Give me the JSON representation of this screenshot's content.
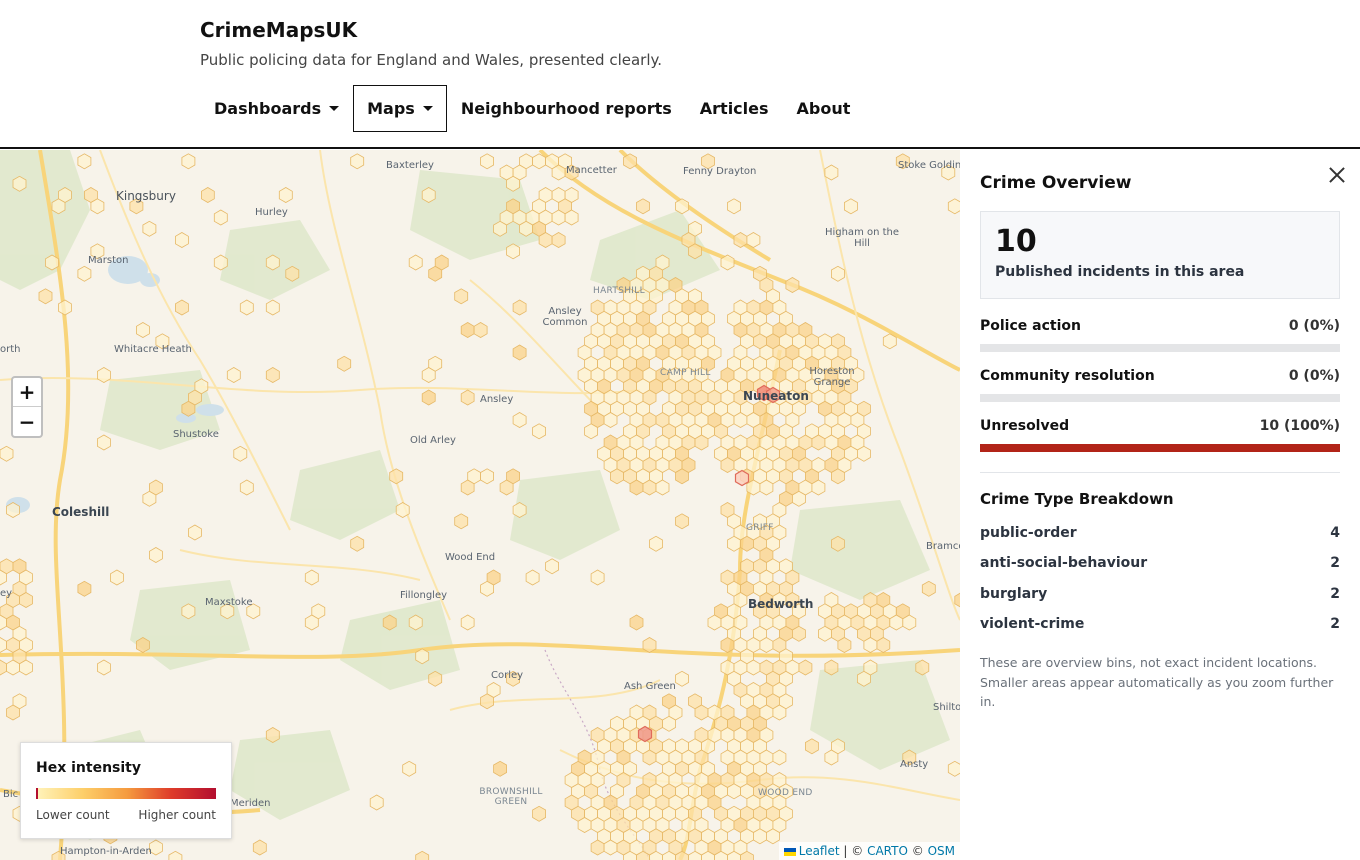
{
  "header": {
    "brand": "CrimeMapsUK",
    "tagline": "Public policing data for England and Wales, presented clearly.",
    "nav": [
      {
        "label": "Dashboards",
        "dropdown": true
      },
      {
        "label": "Maps",
        "dropdown": true,
        "active": true
      },
      {
        "label": "Neighbourhood reports"
      },
      {
        "label": "Articles"
      },
      {
        "label": "About"
      }
    ]
  },
  "map": {
    "places": {
      "kingsbury": "Kingsbury",
      "baxterley": "Baxterley",
      "mancetter": "Mancetter",
      "fenny_drayton": "Fenny Drayton",
      "stoke_golding": "Stoke Golding",
      "hurley": "Hurley",
      "higham": "Higham on the Hill",
      "marston": "Marston",
      "hartshill": "HARTSHILL",
      "ansley_common": "Ansley Common",
      "north": "orth",
      "whitacre_heath": "Whitacre Heath",
      "camp_hill": "CAMP HILL",
      "horeston_grange": "Horeston Grange",
      "nuneaton": "Nuneaton",
      "ansley": "Ansley",
      "shustoke": "Shustoke",
      "old_arley": "Old Arley",
      "coleshill": "Coleshill",
      "griff": "GRIFF",
      "bramcote": "Bramco",
      "wood_end": "Wood End",
      "maxstoke": "Maxstoke",
      "fillongley": "Fillongley",
      "bedworth": "Bedworth",
      "corley": "Corley",
      "ash_green": "Ash Green",
      "shilton": "Shilto",
      "brownshill_green": "BROWNSHILL GREEN",
      "wood_end_2": "WOOD END",
      "ansty": "Ansty",
      "meriden": "Meriden",
      "hampton": "Hampton-in-Arden",
      "bick": "Bic",
      "ley": "ey"
    },
    "zoom_in": "+",
    "zoom_out": "−",
    "legend": {
      "title": "Hex intensity",
      "low": "Lower count",
      "high": "Higher count"
    },
    "attribution": {
      "leaflet": "Leaflet",
      "sep1": "| ©",
      "carto": "CARTO",
      "sep2": "©",
      "osm": "OSM"
    }
  },
  "panel": {
    "title": "Crime Overview",
    "total": "10",
    "total_label": "Published incidents in this area",
    "outcomes": [
      {
        "label": "Police action",
        "value": "0 (0%)",
        "fraction": 0
      },
      {
        "label": "Community resolution",
        "value": "0 (0%)",
        "fraction": 0
      },
      {
        "label": "Unresolved",
        "value": "10 (100%)",
        "fraction": 1
      }
    ],
    "breakdown_title": "Crime Type Breakdown",
    "types": [
      {
        "label": "public-order",
        "count": "4"
      },
      {
        "label": "anti-social-behaviour",
        "count": "2"
      },
      {
        "label": "burglary",
        "count": "2"
      },
      {
        "label": "violent-crime",
        "count": "2"
      }
    ],
    "note": "These are overview bins, not exact incident locations. Smaller areas appear automatically as you zoom further in."
  }
}
